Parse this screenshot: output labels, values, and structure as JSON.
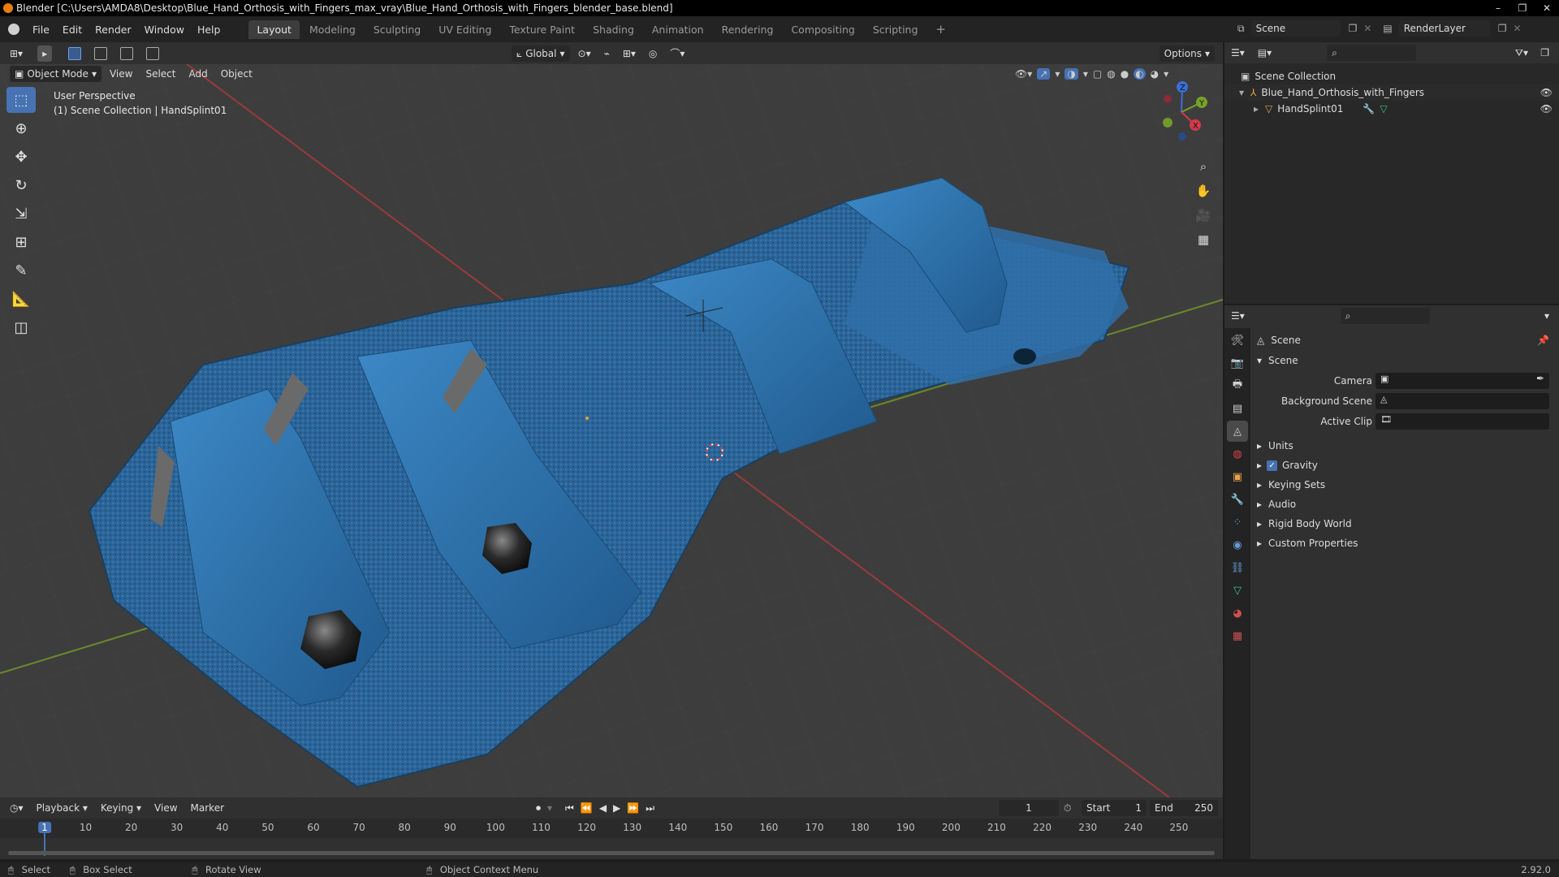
{
  "window": {
    "title": "Blender [C:\\Users\\AMDA8\\Desktop\\Blue_Hand_Orthosis_with_Fingers_max_vray\\Blue_Hand_Orthosis_with_Fingers_blender_base.blend]",
    "min": "–",
    "max": "❐",
    "close": "✕"
  },
  "menu": {
    "items": [
      "File",
      "Edit",
      "Render",
      "Window",
      "Help"
    ]
  },
  "workspaces": {
    "tabs": [
      "Layout",
      "Modeling",
      "Sculpting",
      "UV Editing",
      "Texture Paint",
      "Shading",
      "Animation",
      "Rendering",
      "Compositing",
      "Scripting"
    ],
    "active": "Layout",
    "add": "+"
  },
  "topright": {
    "scene": "Scene",
    "render_layer": "RenderLayer"
  },
  "viewport_header": {
    "transform_orientation": "Global",
    "options": "Options"
  },
  "viewport_menu": {
    "mode": "Object Mode",
    "items": [
      "View",
      "Select",
      "Add",
      "Object"
    ]
  },
  "viewport": {
    "perspective": "User Perspective",
    "collection_info": "(1) Scene Collection | HandSplint01",
    "axis_x": "X",
    "axis_y": "Y",
    "axis_z": "Z"
  },
  "outliner": {
    "root": "Scene Collection",
    "items": [
      {
        "label": "Blue_Hand_Orthosis_with_Fingers"
      },
      {
        "label": "HandSplint01"
      }
    ]
  },
  "properties": {
    "header": "Scene",
    "panel": "Scene",
    "camera_label": "Camera",
    "bg_scene_label": "Background Scene",
    "active_clip_label": "Active Clip",
    "sections": [
      "Units",
      "Gravity",
      "Keying Sets",
      "Audio",
      "Rigid Body World",
      "Custom Properties"
    ],
    "gravity_checked": true
  },
  "timeline": {
    "menus": [
      "Playback",
      "Keying",
      "View",
      "Marker"
    ],
    "current_frame": "1",
    "start_label": "Start",
    "start": "1",
    "end_label": "End",
    "end": "250",
    "ruler": [
      "1",
      "10",
      "20",
      "30",
      "40",
      "50",
      "60",
      "70",
      "80",
      "90",
      "100",
      "110",
      "120",
      "130",
      "140",
      "150",
      "160",
      "170",
      "180",
      "190",
      "200",
      "210",
      "220",
      "230",
      "240",
      "250"
    ]
  },
  "statusbar": {
    "select": "Select",
    "box_select": "Box Select",
    "rotate_view": "Rotate View",
    "context_menu": "Object Context Menu",
    "version": "2.92.0"
  },
  "colors": {
    "accent": "#4772b3",
    "splint_blue": "#2f6fa8",
    "splint_dark": "#1f4a70",
    "grid_red": "#9b3a3a",
    "grid_green": "#6b8a2a"
  }
}
